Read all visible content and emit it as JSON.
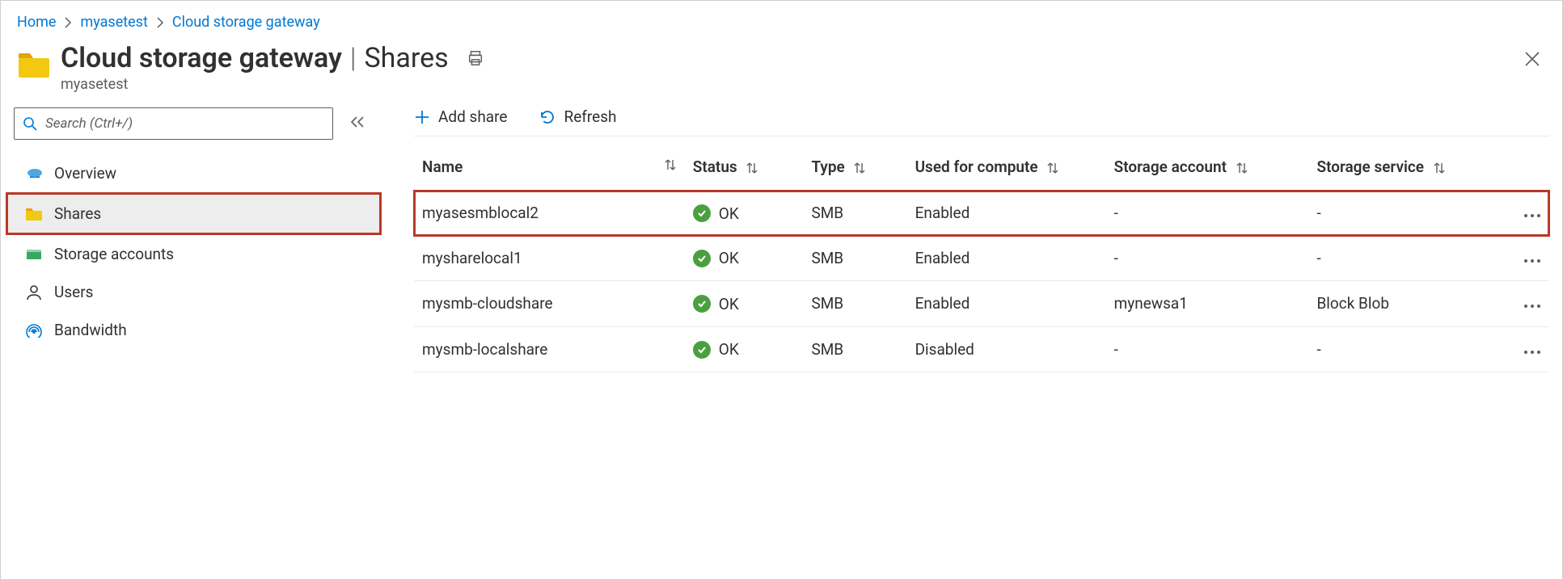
{
  "breadcrumb": [
    {
      "label": "Home"
    },
    {
      "label": "myasetest"
    },
    {
      "label": "Cloud storage gateway"
    }
  ],
  "header": {
    "title": "Cloud storage gateway",
    "section": "Shares",
    "subtitle": "myasetest"
  },
  "search": {
    "placeholder": "Search (Ctrl+/)"
  },
  "nav": {
    "overview": "Overview",
    "shares": "Shares",
    "storage_accounts": "Storage accounts",
    "users": "Users",
    "bandwidth": "Bandwidth"
  },
  "toolbar": {
    "add_share": "Add share",
    "refresh": "Refresh"
  },
  "table": {
    "headers": {
      "name": "Name",
      "status": "Status",
      "type": "Type",
      "compute": "Used for compute",
      "account": "Storage account",
      "service": "Storage service"
    },
    "rows": [
      {
        "name": "myasesmblocal2",
        "status": "OK",
        "type": "SMB",
        "compute": "Enabled",
        "account": "-",
        "service": "-",
        "highlight": true
      },
      {
        "name": "mysharelocal1",
        "status": "OK",
        "type": "SMB",
        "compute": "Enabled",
        "account": "-",
        "service": "-",
        "highlight": false
      },
      {
        "name": "mysmb-cloudshare",
        "status": "OK",
        "type": "SMB",
        "compute": "Enabled",
        "account": "mynewsa1",
        "service": "Block Blob",
        "highlight": false
      },
      {
        "name": "mysmb-localshare",
        "status": "OK",
        "type": "SMB",
        "compute": "Disabled",
        "account": "-",
        "service": "-",
        "highlight": false
      }
    ]
  }
}
